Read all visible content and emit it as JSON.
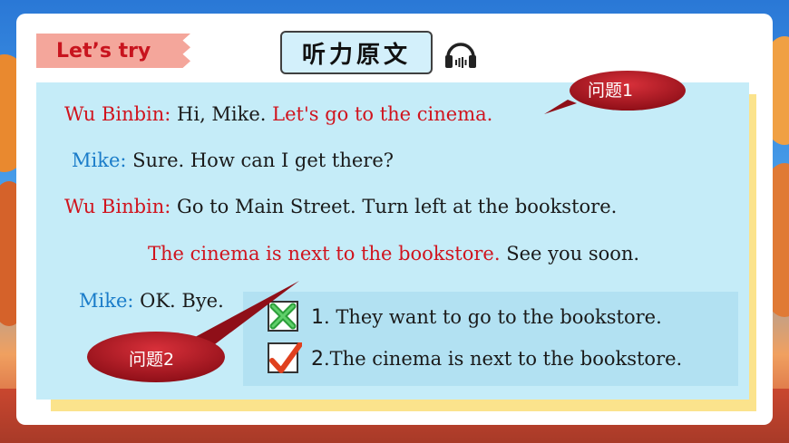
{
  "header": {
    "lets_try": "Let’s try",
    "title": "听力原文"
  },
  "transcript": {
    "line1": {
      "speaker": "Wu Binbin:",
      "plain": " Hi, Mike. ",
      "highlight": "Let's go to the cinema."
    },
    "line2": {
      "speaker": "Mike:",
      "plain": " Sure. How can I get there?"
    },
    "line3": {
      "speaker": "Wu Binbin:",
      "plain": " Go to Main Street. Turn left at the bookstore."
    },
    "line4": {
      "highlight": "The cinema is next to the bookstore.",
      "plain": " See you soon."
    },
    "line5": {
      "speaker": "Mike:",
      "plain": " OK. Bye."
    }
  },
  "answers": [
    {
      "number": "1",
      "text": ". They want to go to the bookstore.",
      "mark": "wrong-icon"
    },
    {
      "number": "2",
      "text": ".The cinema is next to the bookstore.",
      "mark": "correct-icon"
    }
  ],
  "callouts": {
    "q1": "问题1",
    "q2": "问题2"
  },
  "colors": {
    "speaker_red": "#d0141e",
    "speaker_blue": "#1a7cc9",
    "panel": "#c5ecf8",
    "bubble": "#a8121c"
  }
}
